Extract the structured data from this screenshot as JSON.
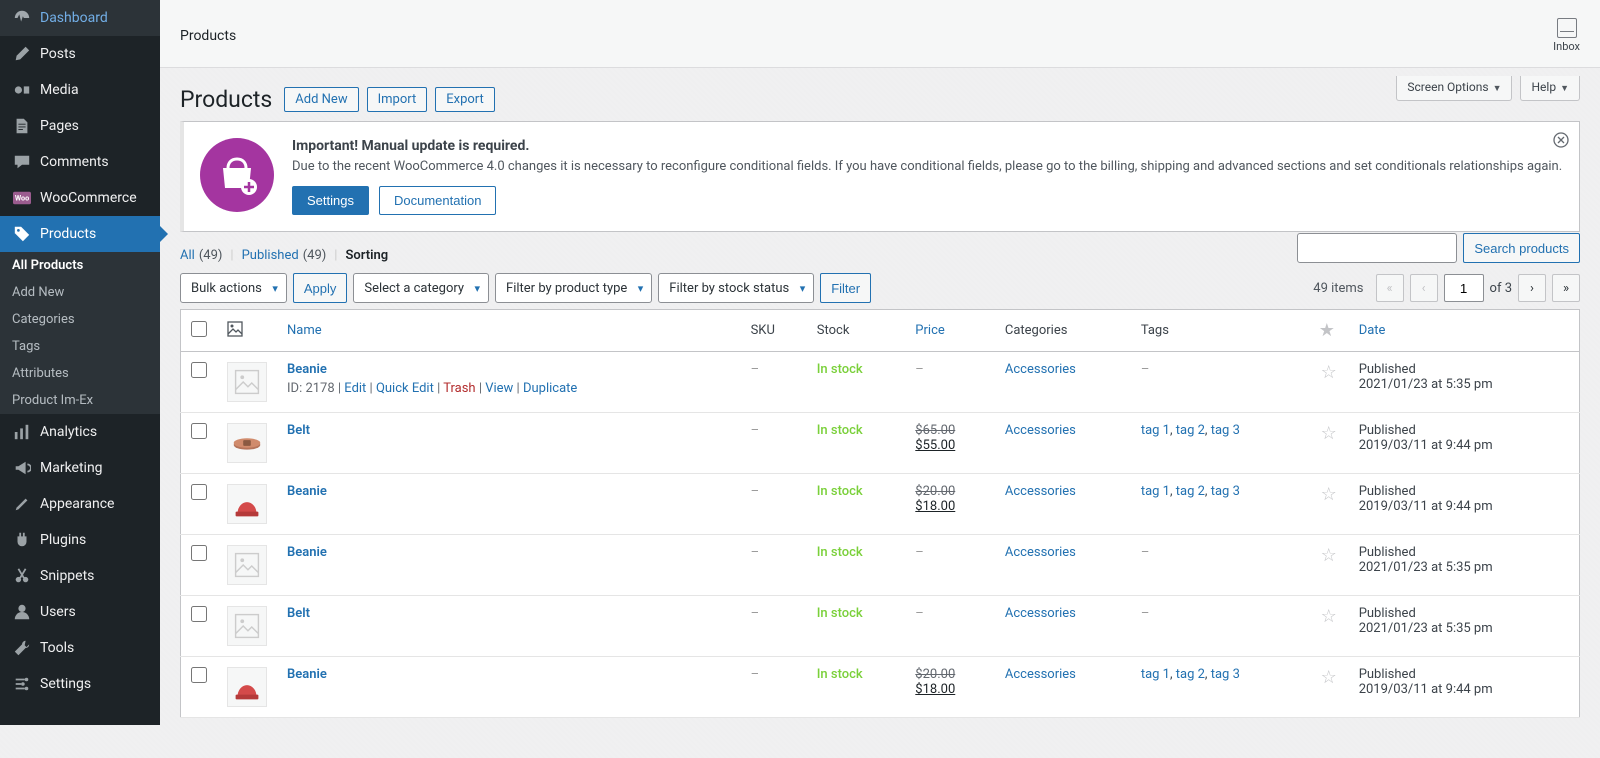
{
  "sidebar": {
    "items": [
      {
        "label": "Dashboard",
        "icon": "dashboard"
      },
      {
        "label": "Posts",
        "icon": "posts"
      },
      {
        "label": "Media",
        "icon": "media"
      },
      {
        "label": "Pages",
        "icon": "pages"
      },
      {
        "label": "Comments",
        "icon": "comments"
      },
      {
        "label": "WooCommerce",
        "icon": "woocommerce"
      },
      {
        "label": "Products",
        "icon": "products",
        "active": true
      },
      {
        "label": "Analytics",
        "icon": "analytics"
      },
      {
        "label": "Marketing",
        "icon": "marketing"
      },
      {
        "label": "Appearance",
        "icon": "appearance"
      },
      {
        "label": "Plugins",
        "icon": "plugins"
      },
      {
        "label": "Snippets",
        "icon": "snippets"
      },
      {
        "label": "Users",
        "icon": "users"
      },
      {
        "label": "Tools",
        "icon": "tools"
      },
      {
        "label": "Settings",
        "icon": "settings"
      }
    ],
    "submenu": [
      {
        "label": "All Products",
        "current": true
      },
      {
        "label": "Add New"
      },
      {
        "label": "Categories"
      },
      {
        "label": "Tags"
      },
      {
        "label": "Attributes"
      },
      {
        "label": "Product Im-Ex"
      }
    ]
  },
  "topbar": {
    "title": "Products",
    "inbox": "Inbox"
  },
  "screenopts": {
    "screen_options": "Screen Options",
    "help": "Help"
  },
  "heading": {
    "title": "Products",
    "add_new": "Add New",
    "import": "Import",
    "export": "Export"
  },
  "notice": {
    "heading": "Important! Manual update is required.",
    "body": "Due to the recent WooCommerce 4.0 changes it is necessary to reconfigure conditional fields. If you have conditional fields, please go to the billing, shipping and advanced sections and set conditionals relationships again.",
    "settings": "Settings",
    "documentation": "Documentation"
  },
  "subsub": {
    "all": "All",
    "all_count": "(49)",
    "published": "Published",
    "published_count": "(49)",
    "sorting": "Sorting"
  },
  "toolbar": {
    "bulk_actions": "Bulk actions",
    "apply": "Apply",
    "select_category": "Select a category",
    "filter_type": "Filter by product type",
    "filter_stock": "Filter by stock status",
    "filter": "Filter",
    "search_products": "Search products",
    "items": "49 items",
    "page": "1",
    "of": "of 3"
  },
  "table": {
    "headers": {
      "name": "Name",
      "sku": "SKU",
      "stock": "Stock",
      "price": "Price",
      "categories": "Categories",
      "tags": "Tags",
      "date": "Date"
    },
    "rows": [
      {
        "name": "Beanie",
        "sku": "–",
        "stock": "In stock",
        "price_old": "",
        "price_new": "",
        "categories": "Accessories",
        "tags": "–",
        "date_status": "Published",
        "date": "2021/01/23 at 5:35 pm",
        "row_actions_id": "ID: 2178",
        "row_actions": [
          "Edit",
          "Quick Edit",
          "Trash",
          "View",
          "Duplicate"
        ],
        "show_actions": true,
        "thumb": "placeholder"
      },
      {
        "name": "Belt",
        "sku": "–",
        "stock": "In stock",
        "price_old": "$65.00",
        "price_new": "$55.00",
        "categories": "Accessories",
        "tags": "tag 1, tag 2, tag 3",
        "date_status": "Published",
        "date": "2019/03/11 at 9:44 pm",
        "thumb": "belt"
      },
      {
        "name": "Beanie",
        "sku": "–",
        "stock": "In stock",
        "price_old": "$20.00",
        "price_new": "$18.00",
        "categories": "Accessories",
        "tags": "tag 1, tag 2, tag 3",
        "date_status": "Published",
        "date": "2019/03/11 at 9:44 pm",
        "thumb": "beanie"
      },
      {
        "name": "Beanie",
        "sku": "–",
        "stock": "In stock",
        "price_old": "",
        "price_new": "",
        "categories": "Accessories",
        "tags": "–",
        "date_status": "Published",
        "date": "2021/01/23 at 5:35 pm",
        "thumb": "placeholder"
      },
      {
        "name": "Belt",
        "sku": "–",
        "stock": "In stock",
        "price_old": "",
        "price_new": "",
        "categories": "Accessories",
        "tags": "–",
        "date_status": "Published",
        "date": "2021/01/23 at 5:35 pm",
        "thumb": "placeholder"
      },
      {
        "name": "Beanie",
        "sku": "–",
        "stock": "In stock",
        "price_old": "$20.00",
        "price_new": "$18.00",
        "categories": "Accessories",
        "tags": "tag 1, tag 2, tag 3",
        "date_status": "Published",
        "date": "2019/03/11 at 9:44 pm",
        "thumb": "beanie"
      }
    ]
  }
}
